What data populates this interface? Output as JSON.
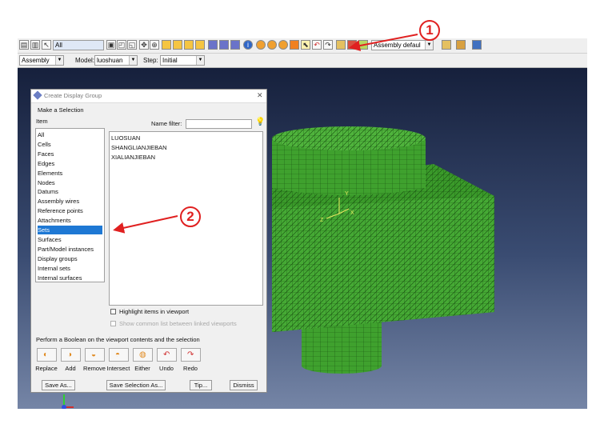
{
  "toolbar": {
    "filter_combo_value": "All",
    "assembly_combo_value": "Assembly defaul",
    "module_combo_value": "Assembly",
    "model_label": "Model:",
    "model_combo_value": "luoshuan",
    "step_label": "Step:",
    "step_combo_value": "Initial"
  },
  "dialog": {
    "title": "Create Display Group",
    "section_label": "Make a Selection",
    "item_header": "Item",
    "name_filter_label": "Name filter:",
    "name_filter_value": "",
    "items": [
      {
        "label": "All"
      },
      {
        "label": "Cells"
      },
      {
        "label": "Faces"
      },
      {
        "label": "Edges"
      },
      {
        "label": "Elements"
      },
      {
        "label": "Nodes"
      },
      {
        "label": "Datums"
      },
      {
        "label": "Assembly wires"
      },
      {
        "label": "Reference points"
      },
      {
        "label": "Attachments"
      },
      {
        "label": "Sets"
      },
      {
        "label": "Surfaces"
      },
      {
        "label": "Part/Model instances"
      },
      {
        "label": "Display groups"
      },
      {
        "label": "Internal sets"
      },
      {
        "label": "Internal surfaces"
      }
    ],
    "selected_item": "Sets",
    "sets": [
      "LUOSUAN",
      "SHANGLIANJIEBAN",
      "XIALIANJIEBAN"
    ],
    "highlight_label": "Highlight items in viewport",
    "highlight_checked": false,
    "show_common_label": "Show common list between linked viewports",
    "boolean_label": "Perform a Boolean on the viewport contents and the selection",
    "boolean_ops": [
      "Replace",
      "Add",
      "Remove",
      "Intersect",
      "Either",
      "Undo",
      "Redo"
    ],
    "buttons": {
      "save_as": "Save As...",
      "save_selection_as": "Save Selection As...",
      "tip": "Tip...",
      "dismiss": "Dismiss"
    }
  },
  "callouts": {
    "one": "1",
    "two": "2"
  },
  "triad_labels": {
    "y": "Y",
    "z": "Z",
    "x": "X"
  },
  "colors": {
    "mesh_green": "#3fa12e",
    "selection_blue": "#1e78d4",
    "callout_red": "#e02020"
  }
}
